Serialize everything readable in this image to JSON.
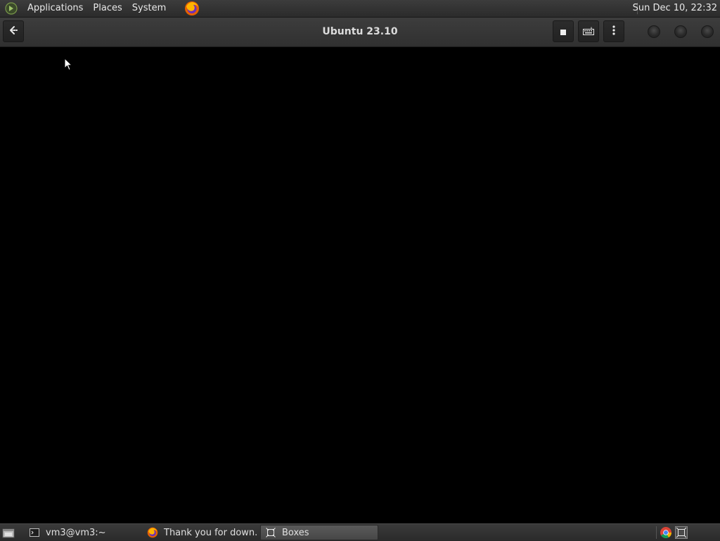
{
  "top_panel": {
    "menus": [
      "Applications",
      "Places",
      "System"
    ],
    "clock": "Sun Dec 10, 22:32",
    "launcher_icon": "firefox-icon"
  },
  "headerbar": {
    "title": "Ubuntu 23.10",
    "buttons": {
      "back": "back-arrow-icon",
      "stop": "stop-icon",
      "keyboard": "keyboard-icon",
      "menu": "kebab-menu-icon"
    },
    "window_controls": [
      "minimize",
      "maximize",
      "close"
    ]
  },
  "taskbar": {
    "tasks": [
      {
        "label": "vm3@vm3:~",
        "icon": "terminal-icon"
      },
      {
        "label": "Thank you for down...",
        "icon": "firefox-icon"
      },
      {
        "label": "Boxes",
        "icon": "boxes-icon",
        "active": true
      }
    ],
    "tray": [
      "chrome-icon",
      "boxes-icon"
    ]
  },
  "colors": {
    "panel": "#2f2f2f",
    "headerbar": "#353535",
    "display": "#000000"
  }
}
